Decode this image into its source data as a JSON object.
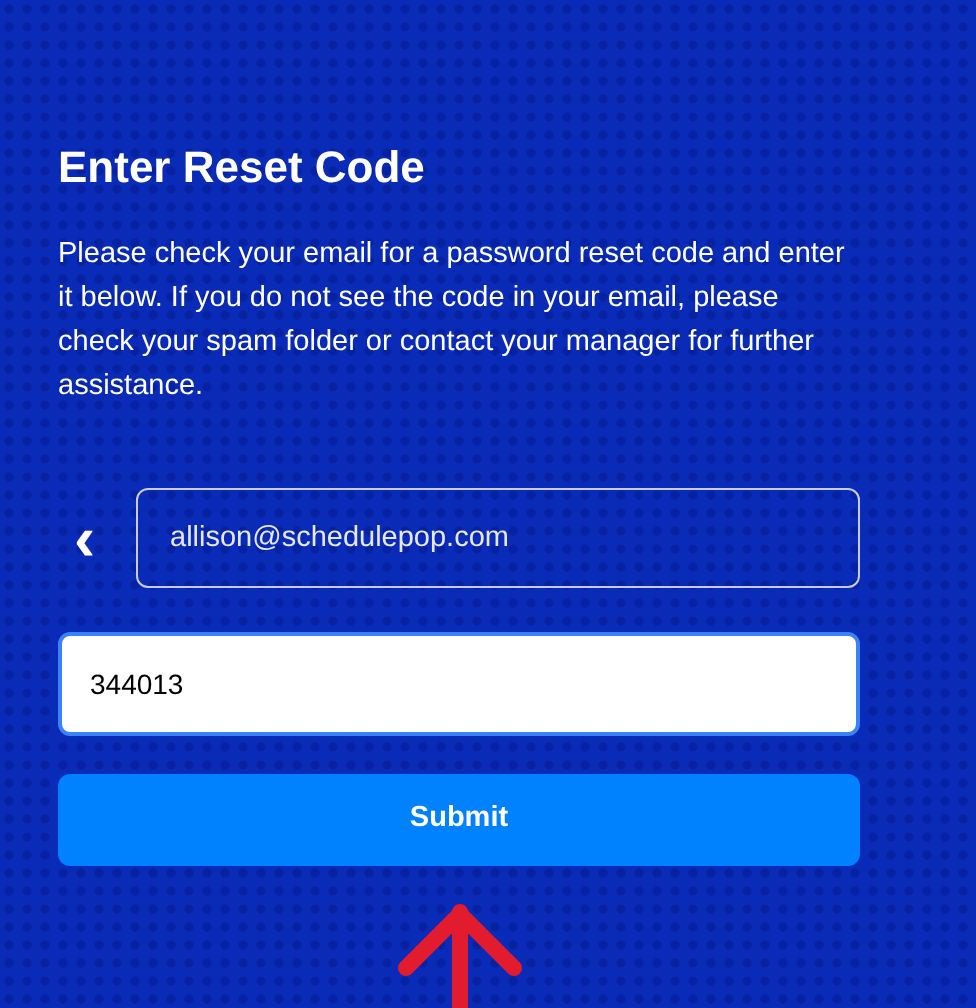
{
  "heading": "Enter Reset Code",
  "instructions": "Please check your email for a password reset code and enter it below. If you do not see the code in your email, please check your spam folder or contact your manager for further assistance.",
  "back_button": {
    "label": "‹"
  },
  "email_field": {
    "value": "allison@schedulepop.com"
  },
  "code_field": {
    "value": "344013"
  },
  "submit_button": {
    "label": "Submit"
  },
  "annotation": {
    "kind": "arrow"
  }
}
